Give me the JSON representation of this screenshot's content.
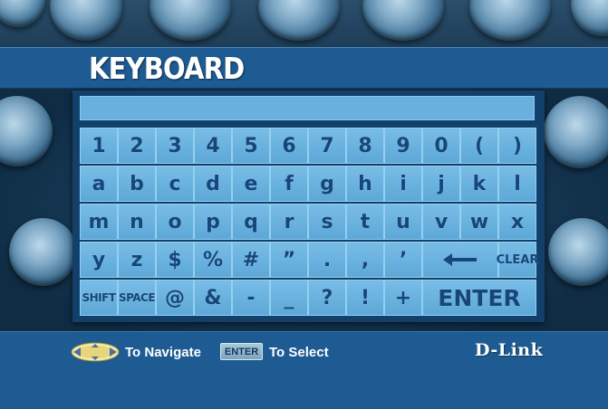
{
  "header": {
    "title": "KEYBOARD"
  },
  "input": {
    "value": ""
  },
  "keyboard": {
    "rows": [
      [
        "1",
        "2",
        "3",
        "4",
        "5",
        "6",
        "7",
        "8",
        "9",
        "0",
        "(",
        ")"
      ],
      [
        "a",
        "b",
        "c",
        "d",
        "e",
        "f",
        "g",
        "h",
        "i",
        "j",
        "k",
        "l"
      ],
      [
        "m",
        "n",
        "o",
        "p",
        "q",
        "r",
        "s",
        "t",
        "u",
        "v",
        "w",
        "x"
      ],
      [
        "y",
        "z",
        "$",
        "%",
        "#",
        "”",
        ".",
        ",",
        "’",
        "←",
        "CLEAR"
      ],
      [
        "SHIFT",
        "SPACE",
        "@",
        "&",
        "-",
        "_",
        "?",
        "!",
        "+",
        "ENTER"
      ]
    ]
  },
  "footer": {
    "navigate_label": "To Navigate",
    "enter_badge": "ENTER",
    "select_label": "To Select",
    "brand": "D-Link"
  },
  "colors": {
    "key_face": "#6aafdf",
    "key_text": "#16467a",
    "panel": "#12406b",
    "band": "#1d5b92"
  },
  "icons": {
    "navigate": "dpad-arrows-icon",
    "backspace": "left-arrow-icon"
  }
}
